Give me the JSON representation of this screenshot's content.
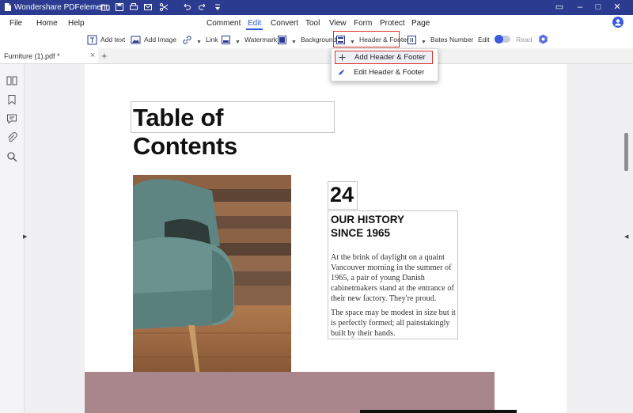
{
  "app": {
    "title": "Wondershare PDFelement"
  },
  "menu": {
    "file": "File",
    "home": "Home",
    "help": "Help",
    "comment": "Comment",
    "edit": "Edit",
    "convert": "Convert",
    "tool": "Tool",
    "view": "View",
    "form": "Form",
    "protect": "Protect",
    "page": "Page"
  },
  "toolbar": {
    "add_text": "Add text",
    "add_image": "Add Image",
    "link": "Link",
    "watermark": "Watermark",
    "background": "Background",
    "header_footer": "Header & Footer",
    "bates_number": "Bates Number",
    "edit_mode": "Edit",
    "read_mode": "Read"
  },
  "tab": {
    "label": "Furniture (1).pdf *",
    "close": "×",
    "new": "+"
  },
  "dropdown": {
    "add": "Add Header & Footer",
    "edit": "Edit Header & Footer"
  },
  "document": {
    "heading": "Table of Contents",
    "page_number": "24",
    "story_title_line1": "OUR HISTORY",
    "story_title_line2": "SINCE 1965",
    "paragraph1": "At the brink of daylight on a quaint Vancouver morning in the summer of 1965, a pair of young Danish cabinetmakers stand at the entrance of their new factory. They're proud.",
    "paragraph2": "The space may be modest in size but it is perfectly formed; all painstakingly built by their hands."
  },
  "colors": {
    "titlebar": "#2b3b8f",
    "accent": "#2b5bd7",
    "highlight": "#d9342b",
    "band": "#a9868c"
  }
}
